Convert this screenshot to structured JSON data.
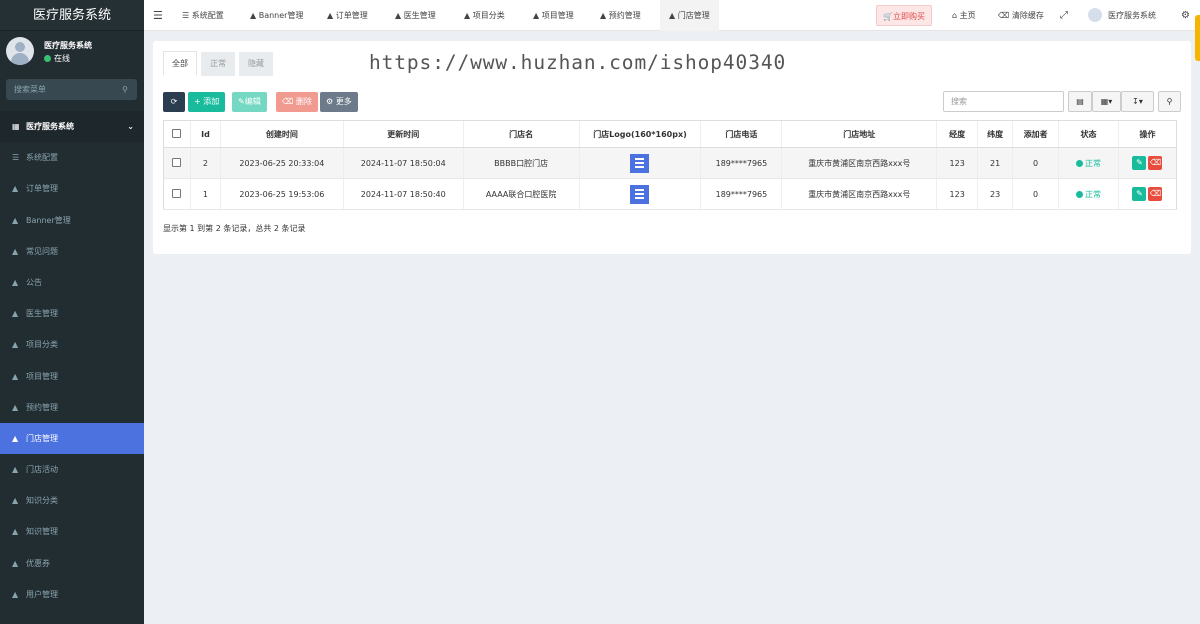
{
  "app": {
    "title": "医疗服务系统",
    "user": "医疗服务系统",
    "status": "在线",
    "search_placeholder": "搜索菜单"
  },
  "sidebar": {
    "group": "医疗服务系统",
    "items": [
      {
        "label": "系统配置",
        "icon": "sliders-icon"
      },
      {
        "label": "订单管理",
        "icon": "sitemap-icon"
      },
      {
        "label": "Banner管理",
        "icon": "sitemap-icon"
      },
      {
        "label": "常见问题",
        "icon": "sitemap-icon"
      },
      {
        "label": "公告",
        "icon": "sitemap-icon"
      },
      {
        "label": "医生管理",
        "icon": "sitemap-icon"
      },
      {
        "label": "项目分类",
        "icon": "sitemap-icon"
      },
      {
        "label": "项目管理",
        "icon": "sitemap-icon"
      },
      {
        "label": "预约管理",
        "icon": "sitemap-icon"
      },
      {
        "label": "门店管理",
        "icon": "sitemap-icon",
        "active": true
      },
      {
        "label": "门店活动",
        "icon": "sitemap-icon"
      },
      {
        "label": "知识分类",
        "icon": "sitemap-icon"
      },
      {
        "label": "知识管理",
        "icon": "sitemap-icon"
      },
      {
        "label": "优惠券",
        "icon": "sitemap-icon"
      },
      {
        "label": "用户管理",
        "icon": "sitemap-icon"
      }
    ]
  },
  "topnav": {
    "tabs": [
      "系统配置",
      "Banner管理",
      "订单管理",
      "医生管理",
      "项目分类",
      "项目管理",
      "预约管理",
      "门店管理"
    ],
    "buy": "立即购买",
    "home": "主页",
    "clear_cache": "清除缓存",
    "user": "医疗服务系统"
  },
  "watermark": "https://www.huzhan.com/ishop40340",
  "filter_tabs": [
    "全部",
    "正常",
    "隐藏"
  ],
  "toolbar": {
    "add": "添加",
    "edit": "编辑",
    "delete": "删除",
    "more": "更多",
    "search_placeholder": "搜索"
  },
  "table": {
    "headers": [
      "Id",
      "创建时间",
      "更新时间",
      "门店名",
      "门店Logo(160*160px)",
      "门店电话",
      "门店地址",
      "经度",
      "纬度",
      "添加者",
      "状态",
      "操作"
    ],
    "rows": [
      {
        "id": "2",
        "created": "2023-06-25 20:33:04",
        "updated": "2024-11-07 18:50:04",
        "name": "BBBB口腔门店",
        "phone": "189****7965",
        "address": "重庆市黄浦区南京西路xxx号",
        "lng": "123",
        "lat": "21",
        "adder": "0",
        "status": "正常"
      },
      {
        "id": "1",
        "created": "2023-06-25 19:53:06",
        "updated": "2024-11-07 18:50:40",
        "name": "AAAA联合口腔医院",
        "phone": "189****7965",
        "address": "重庆市黄浦区南京西路xxx号",
        "lng": "123",
        "lat": "23",
        "adder": "0",
        "status": "正常"
      }
    ],
    "pagination": "显示第 1 到第 2 条记录，总共 2 条记录"
  }
}
